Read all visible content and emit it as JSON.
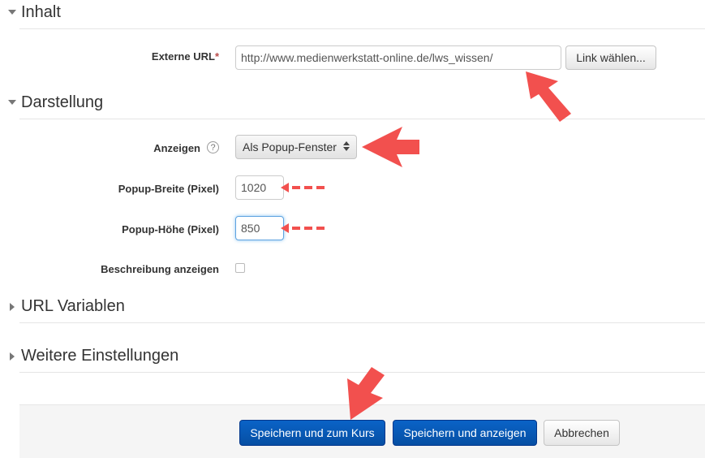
{
  "sections": {
    "inhalt": "Inhalt",
    "darstellung": "Darstellung",
    "url_variablen": "URL Variablen",
    "weitere": "Weitere Einstellungen"
  },
  "inhalt": {
    "external_url_label": "Externe URL",
    "required_mark": "*",
    "external_url_value": "http://www.medienwerkstatt-online.de/lws_wissen/",
    "choose_link_button": "Link wählen..."
  },
  "darstellung": {
    "anzeigen_label": "Anzeigen",
    "anzeigen_value": "Als Popup-Fenster",
    "popup_width_label": "Popup-Breite (Pixel)",
    "popup_width_value": "1020",
    "popup_height_label": "Popup-Höhe (Pixel)",
    "popup_height_value": "850",
    "show_description_label": "Beschreibung anzeigen",
    "show_description_checked": false
  },
  "footer": {
    "save_return_label": "Speichern und zum Kurs",
    "save_display_label": "Speichern und anzeigen",
    "cancel_label": "Abbrechen"
  },
  "colors": {
    "primary_button": "#0a5bb8",
    "annotation_arrow": "#f2504e",
    "required": "#b94a48",
    "focus_border": "#5fa3e0"
  },
  "icons": {
    "expanded_section": "triangle-down-icon",
    "collapsed_section": "triangle-right-icon",
    "help": "help-icon",
    "select": "select-updown-icon",
    "annotation": "red-arrow-icon"
  }
}
